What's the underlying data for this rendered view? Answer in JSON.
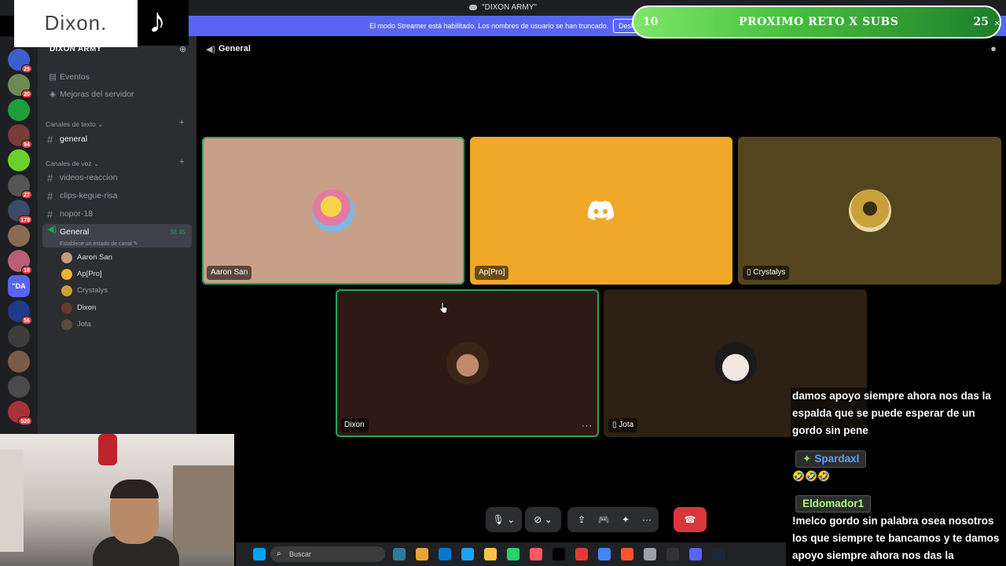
{
  "window": {
    "title": "\"DIXON ARMY\""
  },
  "streamer_banner": {
    "text": "El modo Streamer está habilitado. Los nombres de usuario se han truncado.",
    "button_label": "Desh"
  },
  "server_rail": {
    "servers": [
      {
        "name": "server-1",
        "color": "#3a5fcd",
        "badge": "29"
      },
      {
        "name": "server-2",
        "color": "#6d8a55",
        "badge": "20"
      },
      {
        "name": "server-3",
        "color": "#1f9d3a",
        "badge": ""
      },
      {
        "name": "server-4",
        "color": "#7a3b3b",
        "badge": "94"
      },
      {
        "name": "server-5",
        "color": "#6bd12a",
        "badge": ""
      },
      {
        "name": "server-6",
        "color": "#555555",
        "badge": "27"
      },
      {
        "name": "server-7",
        "color": "#3a4a6a",
        "badge": "179"
      },
      {
        "name": "server-8",
        "color": "#8a6a55",
        "badge": ""
      },
      {
        "name": "server-9",
        "color": "#b85f7a",
        "badge": "18"
      },
      {
        "name": "server-10",
        "color": "#5865f2",
        "badge": ""
      },
      {
        "name": "server-11",
        "color": "#1d3b8a",
        "badge": "56"
      },
      {
        "name": "server-12",
        "color": "#3d3d3d",
        "badge": ""
      },
      {
        "name": "server-13",
        "color": "#7a5a48",
        "badge": ""
      },
      {
        "name": "server-14",
        "color": "#4a4a4a",
        "badge": ""
      },
      {
        "name": "server-15",
        "color": "#a8323a",
        "badge": "520"
      }
    ],
    "dm_label": "\"DA"
  },
  "sidebar": {
    "server_name": "DIXON ARMY",
    "top_items": [
      {
        "label": "Eventos",
        "icon": "calendar-icon"
      },
      {
        "label": "Mejoras del servidor",
        "icon": "boost-icon"
      }
    ],
    "text_category": "Canales de texto",
    "text_channels": [
      {
        "label": "general"
      }
    ],
    "voice_category": "Canales de voz",
    "voice_channels": [
      {
        "label": "videos-reaccion"
      },
      {
        "label": "clips-kegue-risa"
      },
      {
        "label": "nopor-18"
      }
    ],
    "active_channel": {
      "label": "General",
      "time": "38:45",
      "status": "Establece un estado de canal"
    },
    "members": [
      {
        "name": "Aaron San",
        "color": "#c79a7a"
      },
      {
        "name": "Ap[Pro]",
        "color": "#f0b232"
      },
      {
        "name": "Crystalys",
        "color": "#c9a13a"
      },
      {
        "name": "Dixon",
        "color": "#6b3b2a"
      },
      {
        "name": "Jota",
        "color": "#5a4a3a"
      }
    ]
  },
  "voice": {
    "channel_name": "General",
    "tiles": [
      {
        "name": "Aaron San",
        "bg": "#c8a08a",
        "avatar": "#e8b64a",
        "speaking": true,
        "mobile": false
      },
      {
        "name": "Ap[Pro]",
        "bg": "#efa828",
        "avatar": "discord-logo",
        "speaking": false,
        "mobile": false
      },
      {
        "name": "Crystalys",
        "bg": "#55451f",
        "avatar": "#b8922e",
        "speaking": false,
        "mobile": true
      },
      {
        "name": "Dixon",
        "bg": "#2e1a14",
        "avatar": "#6b4030",
        "speaking": true,
        "mobile": false
      },
      {
        "name": "Jota",
        "bg": "#2d2015",
        "avatar": "#d8d8d8",
        "speaking": false,
        "mobile": true
      }
    ],
    "more_label": "···"
  },
  "controls": {
    "mic_icon": "🎙",
    "chevron": "⌄",
    "camera_icon": "⊘",
    "share_icon": "⇪",
    "activity_icon": "🎮",
    "soundboard_icon": "✦",
    "more_icon": "···",
    "leave_icon": "☎"
  },
  "taskbar": {
    "search_placeholder": "Buscar",
    "icons": [
      "#00a4ef",
      "#2d7d9a",
      "#e8a33c",
      "#0078d4",
      "#1da1f2",
      "#f6c343",
      "#25d366",
      "#ff5a5f",
      "#000000",
      "#e53935",
      "#4285f4",
      "#fb542b",
      "#9aa0a6",
      "#333333",
      "#5865f2",
      "#1b2838"
    ]
  },
  "overlays": {
    "logo_text": "Dixon.",
    "sub_goal": {
      "current": "10",
      "label": "PROXIMO RETO X SUBS",
      "target": "25"
    }
  },
  "chat_overlay": {
    "message_1": "damos apoyo siempre ahora nos das la espalda que se puede esperar de un gordo sin pene",
    "user_2": "Spardaxl",
    "user_2_color": "#5aa2ff",
    "emotes_2": "🤣🤣🤣",
    "user_3": "Eldomador1",
    "user_3_color": "#a3ff7a",
    "message_3": "!melco gordo sin palabra osea nosotros los que siempre te bancamos y te damos apoyo siempre ahora nos das la"
  }
}
